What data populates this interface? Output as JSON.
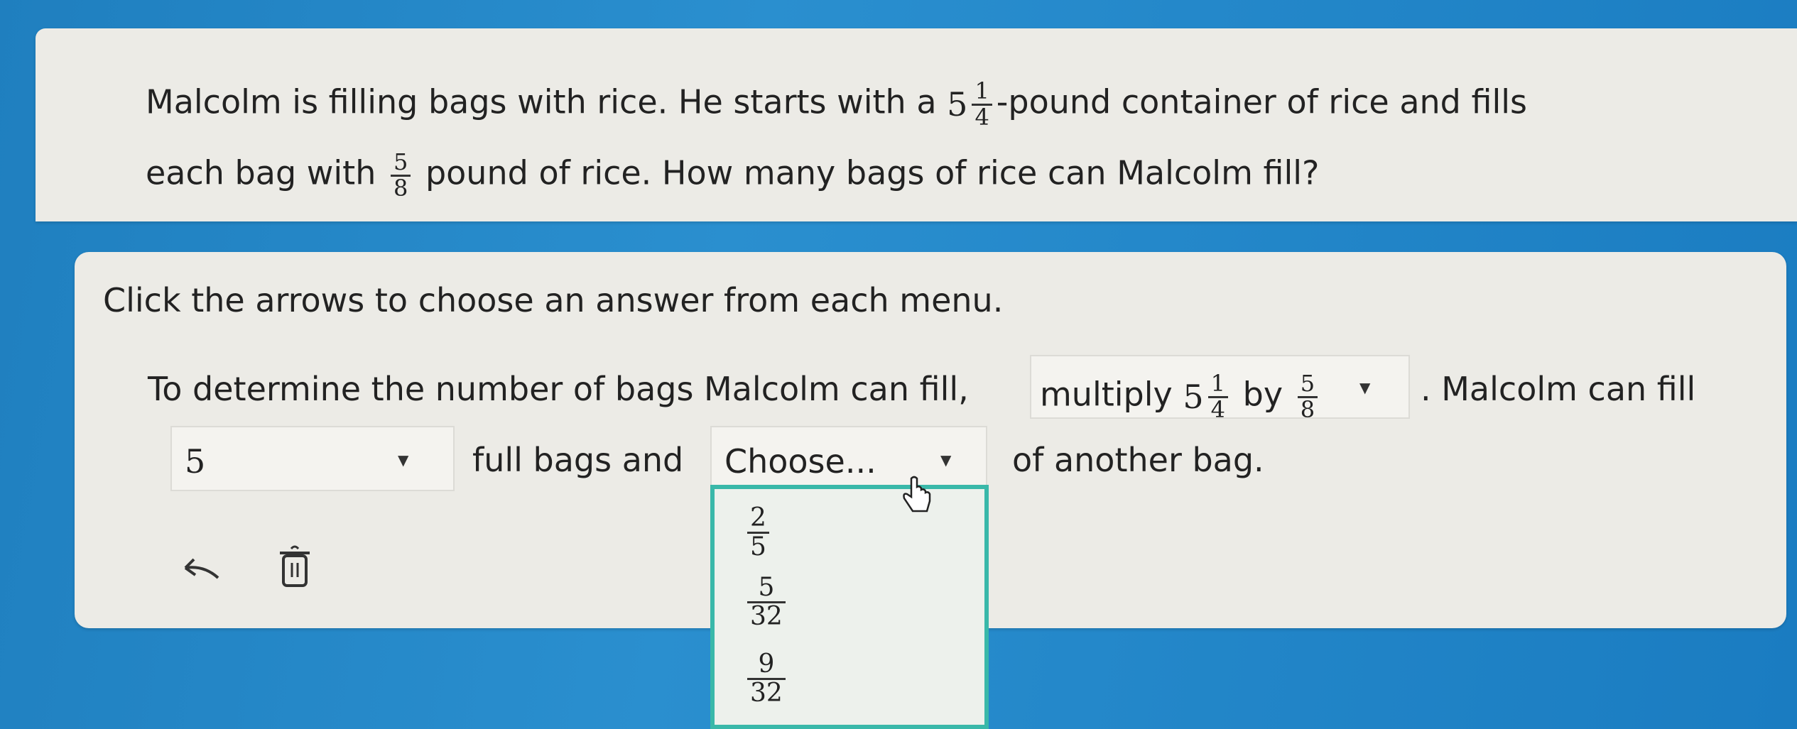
{
  "question": {
    "line1_a": "Malcolm is filling bags with rice. He starts with a",
    "mixed_whole": "5",
    "mixed_num": "1",
    "mixed_den": "4",
    "line1_b": "-pound container of rice and fills",
    "line2_a": "each bag with",
    "frac_num": "5",
    "frac_den": "8",
    "line2_b": "pound of rice. How many bags of rice can Malcolm fill?"
  },
  "answer": {
    "instruction": "Click the arrows to choose an answer from each menu.",
    "sentence_a": "To determine the number of bags Malcolm can fill,",
    "select1": {
      "text": "multiply",
      "whole": "5",
      "num": "1",
      "den": "4",
      "by": "by",
      "num2": "5",
      "den2": "8"
    },
    "sentence_b": ". Malcolm can fill",
    "select2_value": "5",
    "sentence_c": "full bags and",
    "select3_value": "Choose...",
    "sentence_d": "of another bag."
  },
  "dropdown_options": [
    {
      "num": "2",
      "den": "5"
    },
    {
      "num": "5",
      "den": "32"
    },
    {
      "num": "9",
      "den": "32"
    }
  ],
  "icons": {
    "undo": "undo-icon",
    "trash": "trash-icon",
    "cursor": "hand-cursor-icon",
    "arrow": "triangle-down-icon"
  },
  "colors": {
    "background": "#1f7fbf",
    "panel": "#ecebe6",
    "dropdown_border": "#39b8a9"
  }
}
